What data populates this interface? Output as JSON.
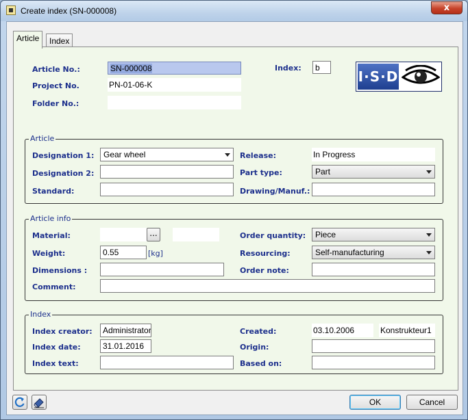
{
  "window": {
    "title": "Create index (SN-000008)",
    "close_glyph": "x"
  },
  "tabs": [
    {
      "label": "Article"
    },
    {
      "label": "Index"
    }
  ],
  "header": {
    "article_no_label": "Article No.:",
    "article_no_value": "SN-000008",
    "project_no_label": "Project No.",
    "project_no_value": "PN-01-06-K",
    "folder_no_label": "Folder No.:",
    "folder_no_value": "",
    "index_label": "Index:",
    "index_value": "b",
    "logo_text": "I·S·D"
  },
  "article": {
    "group_title": "Article",
    "designation1_label": "Designation 1:",
    "designation1_value": "Gear wheel",
    "designation2_label": "Designation 2:",
    "designation2_value": "",
    "standard_label": "Standard:",
    "standard_value": "",
    "release_label": "Release:",
    "release_value": "In Progress",
    "part_type_label": "Part type:",
    "part_type_value": "Part",
    "drawing_label": "Drawing/Manuf.:",
    "drawing_value": ""
  },
  "article_info": {
    "group_title": "Article info",
    "material_label": "Material:",
    "material_value": "",
    "material_browse": "...",
    "weight_label": "Weight:",
    "weight_value": "0.55",
    "weight_unit": "[kg]",
    "dimensions_label": "Dimensions :",
    "dimensions_value": "",
    "comment_label": "Comment:",
    "comment_value": "",
    "order_quantity_label": "Order quantity:",
    "order_quantity_value": "Piece",
    "resourcing_label": "Resourcing:",
    "resourcing_value": "Self-manufacturing",
    "order_note_label": "Order note:",
    "order_note_value": ""
  },
  "index": {
    "group_title": "Index",
    "creator_label": "Index creator:",
    "creator_value": "Administrator",
    "date_label": "Index date:",
    "date_value": "31.01.2016",
    "text_label": "Index text:",
    "text_value": "",
    "created_label": "Created:",
    "created_date": "03.10.2006",
    "created_by": "Konstrukteur1",
    "origin_label": "Origin:",
    "origin_value": "",
    "based_on_label": "Based on:",
    "based_on_value": ""
  },
  "footer": {
    "ok_label": "OK",
    "cancel_label": "Cancel"
  },
  "icons": [
    "refresh-icon",
    "eraser-icon",
    "eye-icon",
    "dropdown-arrow-icon"
  ]
}
